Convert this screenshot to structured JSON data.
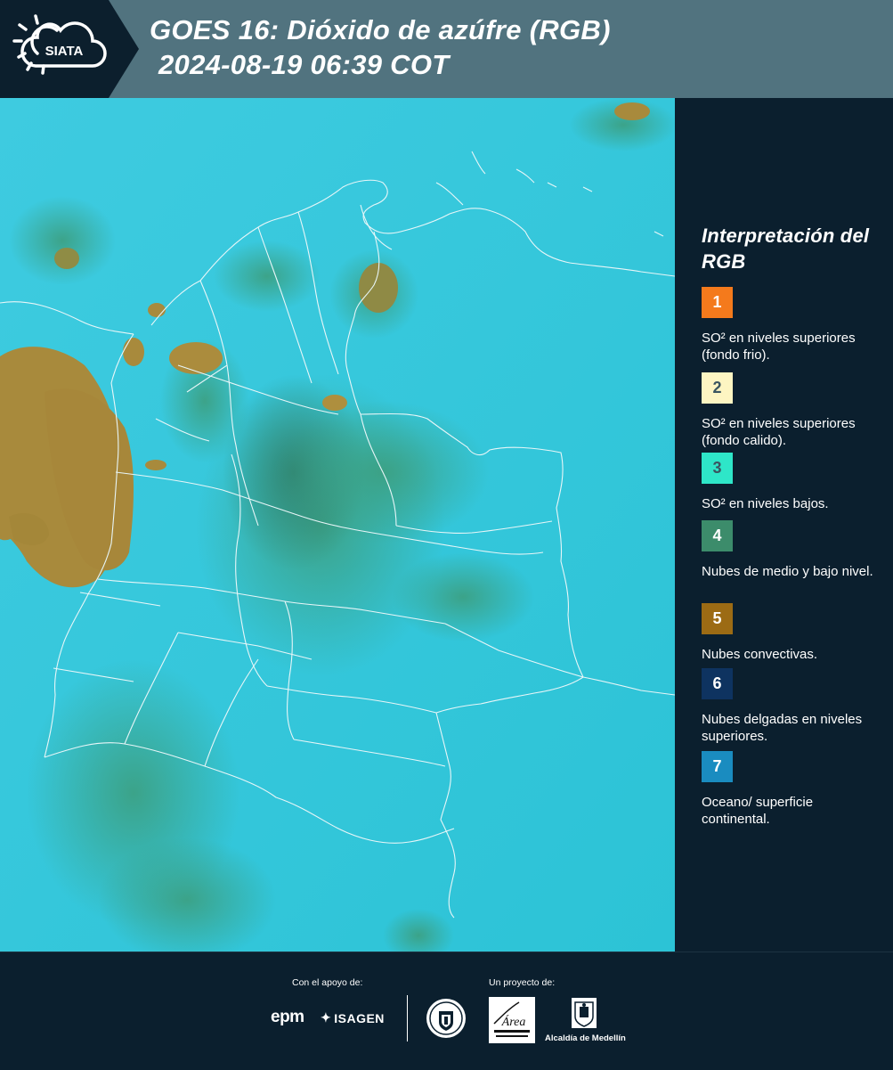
{
  "header": {
    "logo_text": "SIATA",
    "title_line1": "GOES 16: Dióxido de azúfre (RGB)",
    "title_line2": "2024-08-19 06:39 COT",
    "background_color": "#51737f"
  },
  "map": {
    "description_icon": "satellite-map",
    "ocean_color": "#34c8da",
    "convective_cloud_color": "#a98a3a",
    "mid_low_cloud_color": "#3f9a7c"
  },
  "legend": {
    "title": "Interpretación del RGB",
    "items": [
      {
        "number": "1",
        "color": "#f47a1c",
        "label": "SO² en niveles superiores (fondo frio)."
      },
      {
        "number": "2",
        "color": "#fdf5c2",
        "label": "SO² en niveles superiores (fondo calido)."
      },
      {
        "number": "3",
        "color": "#2ee6c8",
        "label": "SO² en niveles bajos."
      },
      {
        "number": "4",
        "color": "#3c8c6b",
        "label": "Nubes de medio y bajo nivel."
      },
      {
        "number": "5",
        "color": "#9c6b14",
        "label": "Nubes convectivas."
      },
      {
        "number": "6",
        "color": "#0e3360",
        "label": "Nubes delgadas en niveles superiores."
      },
      {
        "number": "7",
        "color": "#1a8cc0",
        "label": "Oceano/ superficie continental."
      }
    ]
  },
  "footer": {
    "support_label": "Con el apoyo de:",
    "project_label": "Un proyecto de:",
    "epm_logo_text": "epm",
    "isagen_logo_text": "ISAGEN",
    "area_logo_text": "Área",
    "alcaldia_label": "Alcaldía de Medellín"
  }
}
